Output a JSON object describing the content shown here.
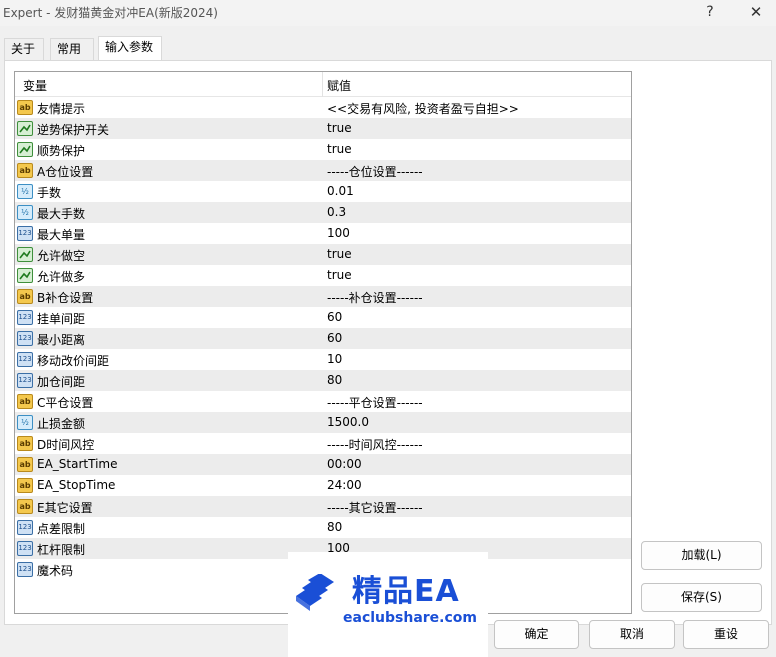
{
  "window": {
    "title": "Expert - 发财猫黄金对冲EA(新版2024)",
    "help_label": "?",
    "close_label": "✕"
  },
  "tabs": [
    {
      "label": "关于"
    },
    {
      "label": "常用"
    },
    {
      "label": "输入参数"
    }
  ],
  "grid": {
    "header_name": "变量",
    "header_value": "赋值",
    "rows": [
      {
        "type": "string",
        "icon": "ab",
        "name": "友情提示",
        "value": "<<交易有风险, 投资者盈亏自担>>"
      },
      {
        "type": "bool",
        "icon": "bool-icon",
        "name": "逆势保护开关",
        "value": "true"
      },
      {
        "type": "bool",
        "icon": "bool-icon",
        "name": "顺势保护",
        "value": "true"
      },
      {
        "type": "string",
        "icon": "ab",
        "name": "A仓位设置",
        "value": "-----仓位设置------"
      },
      {
        "type": "double",
        "icon": "½",
        "name": "手数",
        "value": "0.01"
      },
      {
        "type": "double",
        "icon": "½",
        "name": "最大手数",
        "value": "0.3"
      },
      {
        "type": "int",
        "icon": "123",
        "name": "最大单量",
        "value": "100"
      },
      {
        "type": "bool",
        "icon": "bool-icon",
        "name": "允许做空",
        "value": "true"
      },
      {
        "type": "bool",
        "icon": "bool-icon",
        "name": "允许做多",
        "value": "true"
      },
      {
        "type": "string",
        "icon": "ab",
        "name": "B补仓设置",
        "value": "-----补仓设置------"
      },
      {
        "type": "int",
        "icon": "123",
        "name": "挂单间距",
        "value": "60"
      },
      {
        "type": "int",
        "icon": "123",
        "name": "最小距离",
        "value": "60"
      },
      {
        "type": "int",
        "icon": "123",
        "name": "移动改价间距",
        "value": "10"
      },
      {
        "type": "int",
        "icon": "123",
        "name": "加仓间距",
        "value": "80"
      },
      {
        "type": "string",
        "icon": "ab",
        "name": "C平仓设置",
        "value": "-----平仓设置------"
      },
      {
        "type": "double",
        "icon": "½",
        "name": "止损金额",
        "value": "1500.0"
      },
      {
        "type": "string",
        "icon": "ab",
        "name": "D时间风控",
        "value": "-----时间风控------"
      },
      {
        "type": "string",
        "icon": "ab",
        "name": "EA_StartTime",
        "value": "00:00"
      },
      {
        "type": "string",
        "icon": "ab",
        "name": "EA_StopTime",
        "value": "24:00"
      },
      {
        "type": "string",
        "icon": "ab",
        "name": "E其它设置",
        "value": "-----其它设置------"
      },
      {
        "type": "int",
        "icon": "123",
        "name": "点差限制",
        "value": "80"
      },
      {
        "type": "int",
        "icon": "123",
        "name": "杠杆限制",
        "value": "100"
      },
      {
        "type": "int",
        "icon": "123",
        "name": "魔术码",
        "value": ""
      }
    ]
  },
  "buttons": {
    "load": "加载(L)",
    "save": "保存(S)",
    "ok": "确定",
    "cancel": "取消",
    "reset": "重设"
  },
  "watermark": {
    "name": "精品EA",
    "url": "eaclubshare.com"
  }
}
